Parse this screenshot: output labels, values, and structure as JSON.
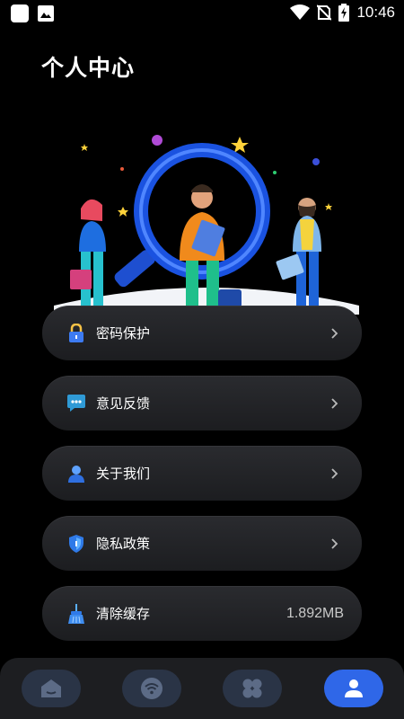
{
  "status_bar": {
    "time": "10:46",
    "icons": [
      "notification-square-icon",
      "image-icon",
      "wifi-icon",
      "no-sim-icon",
      "battery-charging-icon"
    ]
  },
  "page": {
    "title": "个人中心"
  },
  "menu": {
    "items": [
      {
        "label": "密码保护",
        "icon": "lock-icon"
      },
      {
        "label": "意见反馈",
        "icon": "feedback-icon"
      },
      {
        "label": "关于我们",
        "icon": "user-icon"
      },
      {
        "label": "隐私政策",
        "icon": "shield-icon"
      },
      {
        "label": "清除缓存",
        "icon": "broom-icon",
        "value": "1.892MB"
      }
    ]
  },
  "bottom_nav": {
    "tabs": [
      {
        "icon": "home-icon",
        "active": false
      },
      {
        "icon": "wifi-icon",
        "active": false
      },
      {
        "icon": "apps-icon",
        "active": false
      },
      {
        "icon": "profile-icon",
        "active": true
      }
    ]
  },
  "colors": {
    "background": "#000000",
    "card": "#232427",
    "nav_bar": "#1d1e21",
    "nav_inactive": "#2a3446",
    "nav_active": "#2f67e8",
    "nav_icon_inactive": "#5c6b86"
  }
}
